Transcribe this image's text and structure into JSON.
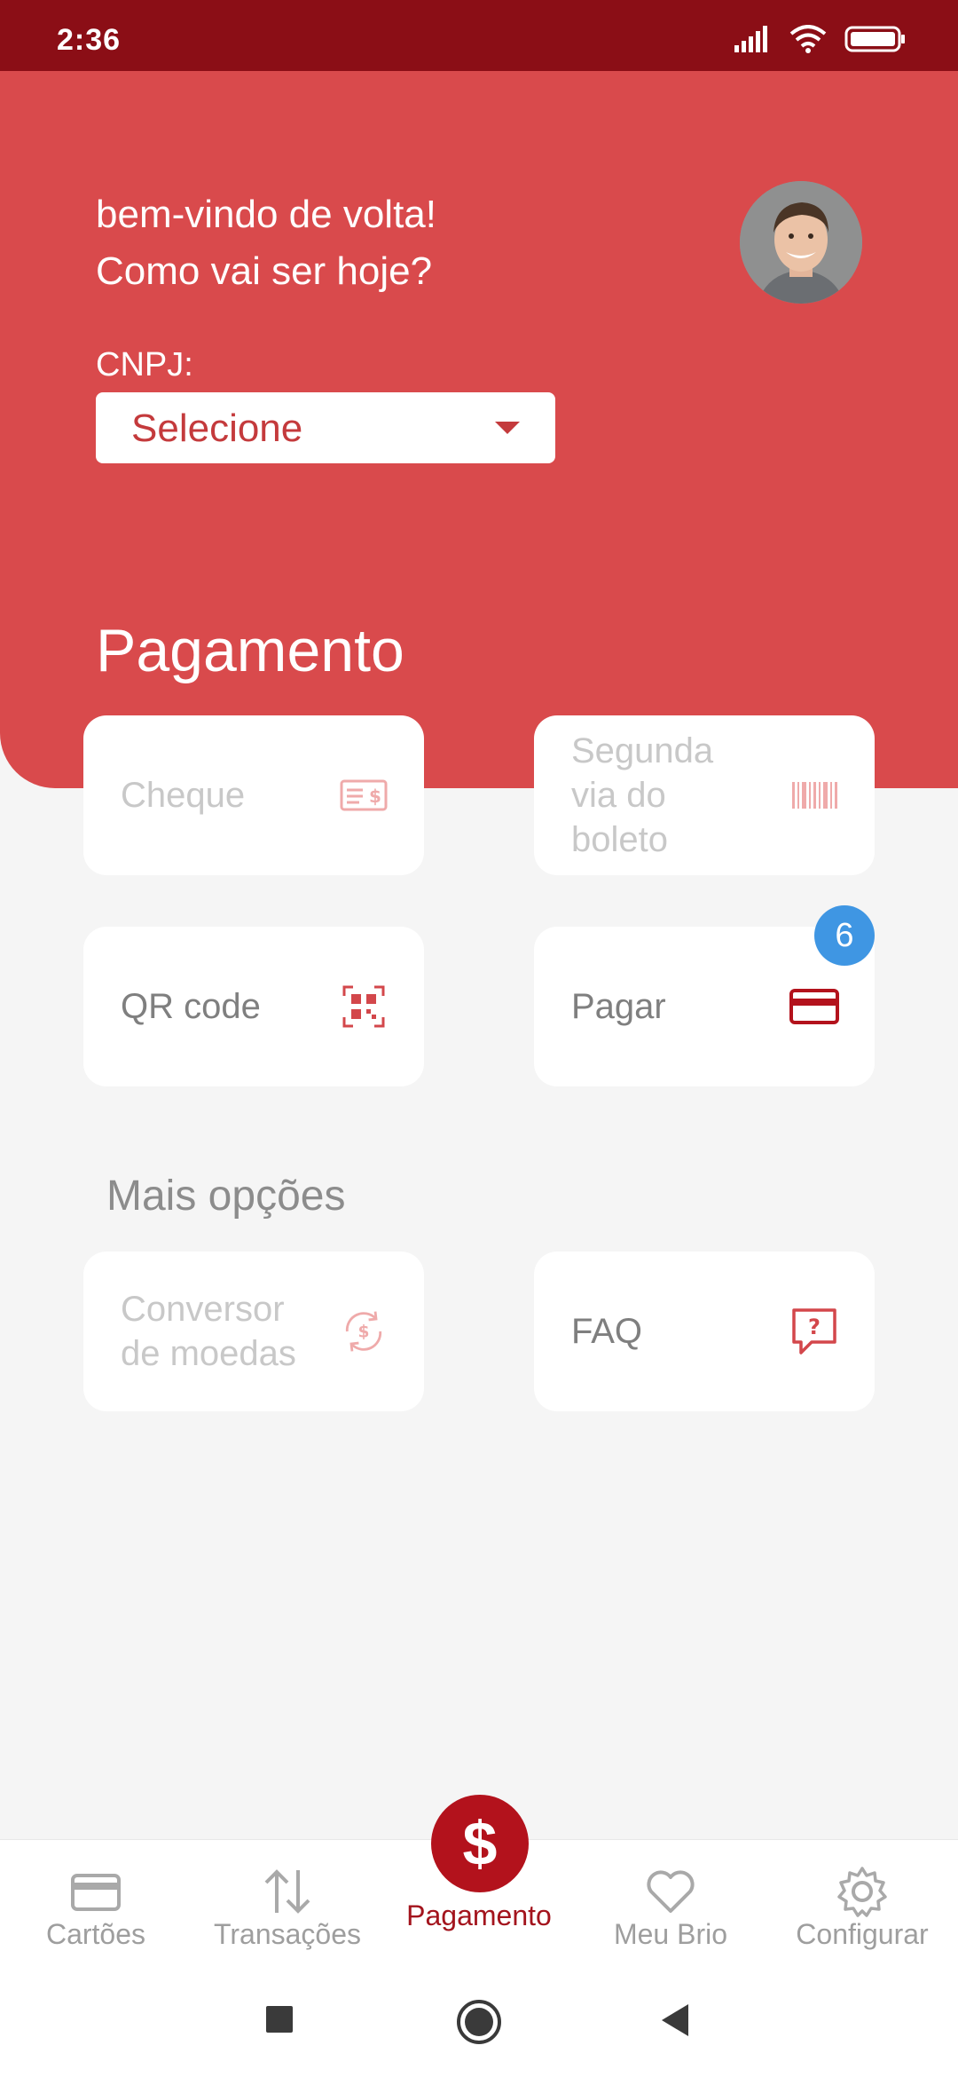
{
  "status_bar": {
    "time": "2:36"
  },
  "header": {
    "greeting_line1": "bem-vindo de volta!",
    "greeting_line2": "Como vai ser hoje?",
    "cnpj_label": "CNPJ:",
    "cnpj_select_value": "Selecione",
    "section_title": "Pagamento"
  },
  "payment_cards": [
    {
      "label": "Cheque",
      "icon": "cheque-icon",
      "enabled": false
    },
    {
      "label": "Segunda via do boleto",
      "icon": "barcode-icon",
      "enabled": false
    },
    {
      "label": "QR code",
      "icon": "qr-code-icon",
      "enabled": true
    },
    {
      "label": "Pagar",
      "icon": "credit-card-icon",
      "enabled": true,
      "badge": "6"
    }
  ],
  "more_options": {
    "title": "Mais opções",
    "cards": [
      {
        "label": "Conversor de moedas",
        "icon": "currency-exchange-icon",
        "enabled": false
      },
      {
        "label": "FAQ",
        "icon": "faq-icon",
        "enabled": true
      }
    ]
  },
  "bottom_nav": {
    "items": [
      {
        "label": "Cartões",
        "icon": "card-icon"
      },
      {
        "label": "Transações",
        "icon": "transfer-icon"
      },
      {
        "label": "Pagamento",
        "icon": "dollar-icon",
        "active": true
      },
      {
        "label": "Meu Brio",
        "icon": "heart-icon"
      },
      {
        "label": "Configurar",
        "icon": "gear-icon"
      }
    ]
  },
  "colors": {
    "status_bar": "#8b0e16",
    "hero": "#d94a4c",
    "accent": "#b3121c",
    "badge": "#3f96e3",
    "background": "#f5f5f5"
  }
}
